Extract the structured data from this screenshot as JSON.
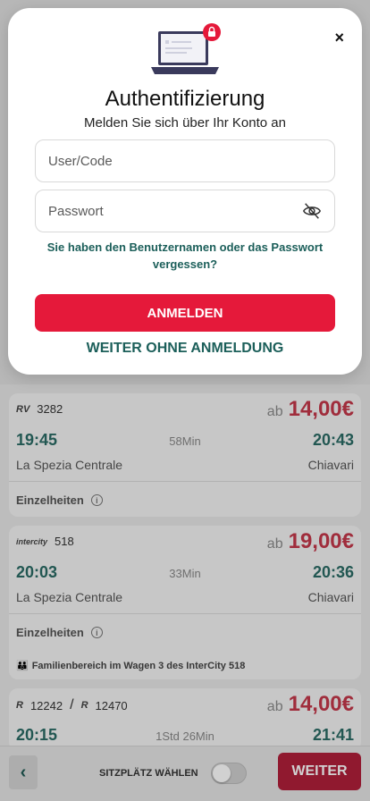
{
  "modal": {
    "title": "Authentifizierung",
    "subtitle": "Melden Sie sich über Ihr Konto an",
    "username_placeholder": "User/Code",
    "password_placeholder": "Passwort",
    "forgot_text": "Sie haben den Benutzernamen oder das Passwort vergessen?",
    "login_label": "ANMELDEN",
    "guest_label": "WEITER OHNE ANMELDUNG",
    "close_symbol": "×",
    "icons": {
      "close": "close-icon",
      "eye": "eye-slash-icon",
      "illustration": "laptop-lock-icon"
    },
    "accent_color": "#e5193a",
    "link_color": "#1c5f5a"
  },
  "results": [
    {
      "train_badge": "RV",
      "train_number": "3282",
      "ab": "ab",
      "price": "14,00€",
      "departure": "19:45",
      "duration": "58Min",
      "arrival": "20:43",
      "from": "La Spezia Centrale",
      "to": "Chiavari",
      "details": "Einzelheiten"
    },
    {
      "train_badge": "intercity",
      "train_number": "518",
      "ab": "ab",
      "price": "19,00€",
      "departure": "20:03",
      "duration": "33Min",
      "arrival": "20:36",
      "from": "La Spezia Centrale",
      "to": "Chiavari",
      "details": "Einzelheiten",
      "note": "Familienbereich im Wagen 3 des InterCity 518"
    },
    {
      "train_badge": "R",
      "train_number": "12242",
      "separator": "/",
      "train_badge2": "R",
      "train_number2": "12470",
      "ab": "ab",
      "price": "14,00€",
      "departure": "20:15",
      "duration": "1Std 26Min",
      "arrival": "21:41"
    }
  ],
  "footer": {
    "back_symbol": "‹",
    "seat_label": "SITZPLÄTZ WÄHLEN",
    "seat_toggle_on": false,
    "next_label": "WEITER"
  }
}
